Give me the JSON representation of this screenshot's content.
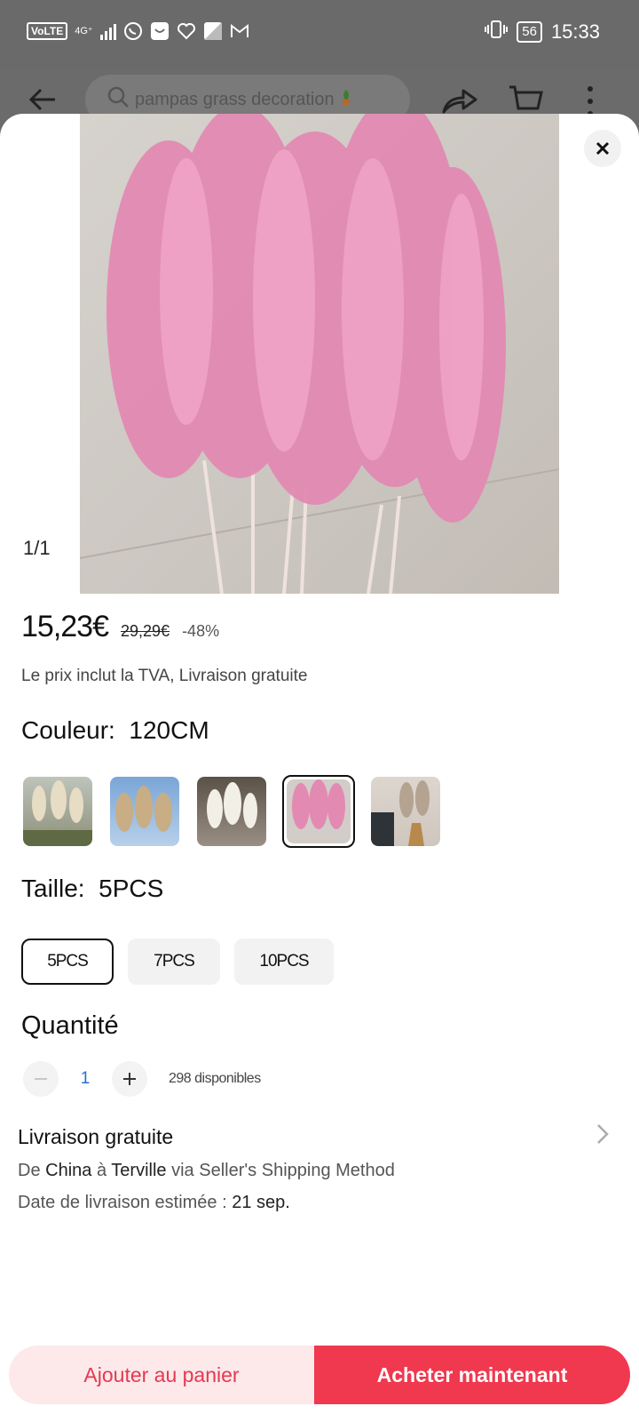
{
  "status_bar": {
    "volte": "VoLTE",
    "network": "4G⁺",
    "battery": "56",
    "time": "15:33"
  },
  "header": {
    "search_text": "pampas grass decoration"
  },
  "gallery": {
    "counter": "1/1"
  },
  "price": {
    "current": "15,23€",
    "original": "29,29€",
    "discount": "-48%"
  },
  "vat_note": "Le prix inclut la TVA, Livraison gratuite",
  "color": {
    "label": "Couleur:",
    "value": "120CM",
    "selected_index": 3
  },
  "size": {
    "label": "Taille:",
    "value": "5PCS",
    "options": [
      "5PCS",
      "7PCS",
      "10PCS"
    ]
  },
  "quantity": {
    "label": "Quantité",
    "value": "1",
    "available": "298 disponibles"
  },
  "shipping": {
    "title": "Livraison gratuite",
    "route_prefix": "De",
    "origin": "China",
    "route_mid": "à",
    "destination": "Terville",
    "route_suffix": "via Seller's Shipping Method",
    "date_prefix": "Date de livraison estimée :",
    "date": "21 sep."
  },
  "actions": {
    "add_to_cart": "Ajouter au panier",
    "buy_now": "Acheter maintenant"
  },
  "colors": {
    "accent": "#f0384f",
    "accent_light": "#fde8ea",
    "link_blue": "#2a6fcf"
  }
}
